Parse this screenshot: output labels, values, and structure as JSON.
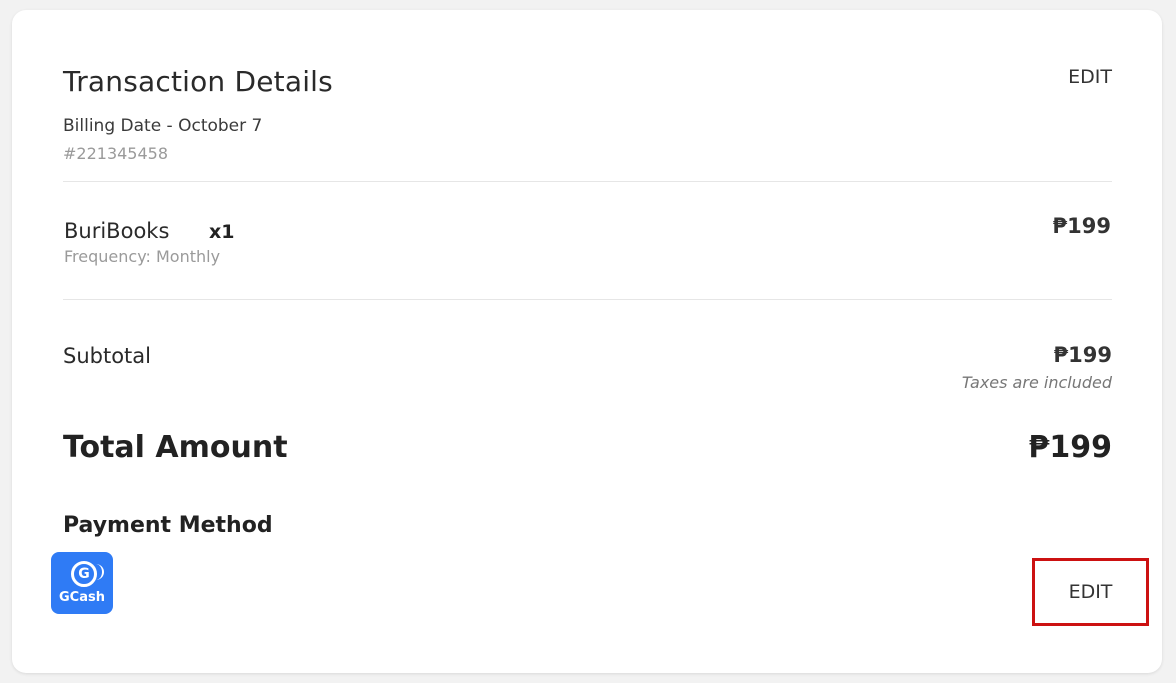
{
  "header": {
    "title": "Transaction Details",
    "edit_label": "EDIT",
    "billing_date": "Billing Date - October 7",
    "order_number": "#221345458"
  },
  "product": {
    "name": "BuriBooks",
    "quantity": "x1",
    "frequency": "Frequency: Monthly",
    "price": "₱199"
  },
  "summary": {
    "subtotal_label": "Subtotal",
    "subtotal_value": "₱199",
    "taxes_note": "Taxes are included",
    "total_label": "Total Amount",
    "total_value": "₱199"
  },
  "payment": {
    "label": "Payment Method",
    "method_logo_text": "GCash",
    "method_logo_glyph": "G",
    "method_icon": "gcash-logo-icon",
    "brand_color": "#2f7bf5",
    "edit_label": "EDIT",
    "highlight_color": "#cc1111"
  }
}
